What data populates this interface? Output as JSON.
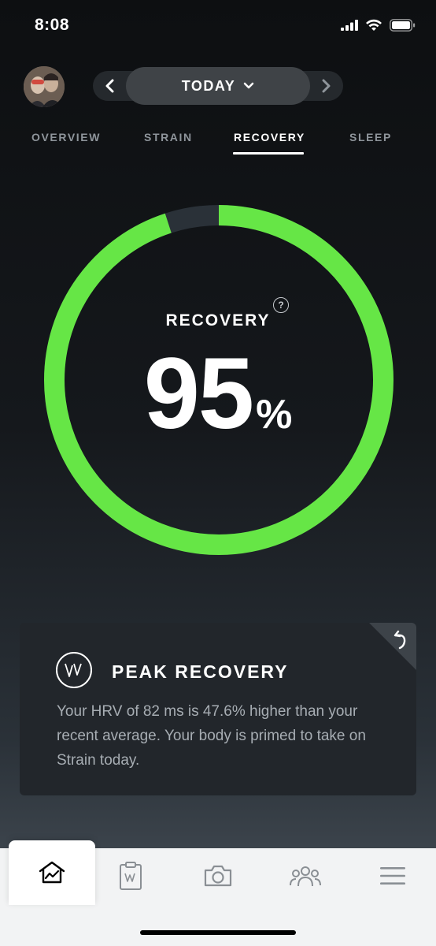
{
  "status_bar": {
    "time": "8:08",
    "signal_icon": "signal-bars-icon",
    "wifi_icon": "wifi-icon",
    "battery_icon": "battery-icon"
  },
  "header": {
    "date_label": "TODAY",
    "prev_icon": "chevron-left-icon",
    "next_icon": "chevron-right-icon",
    "dropdown_icon": "chevron-down-icon"
  },
  "tabs": [
    {
      "label": "OVERVIEW",
      "active": false
    },
    {
      "label": "STRAIN",
      "active": false
    },
    {
      "label": "RECOVERY",
      "active": true
    },
    {
      "label": "SLEEP",
      "active": false
    }
  ],
  "recovery": {
    "title": "RECOVERY",
    "help_label": "?",
    "value": "95",
    "unit": "%",
    "fraction": 0.95,
    "ring_color": "#66e646",
    "track_color": "#2a3138"
  },
  "card": {
    "title": "PEAK RECOVERY",
    "body": "Your HRV of 82 ms is 47.6% higher than your recent average. Your body is primed to take on Strain today.",
    "logo_icon": "whoop-logo-icon",
    "corner_icon": "flip-arrow-icon"
  },
  "tabbar": [
    {
      "name": "home",
      "icon": "home-chart-icon",
      "active": true
    },
    {
      "name": "journal",
      "icon": "clipboard-icon",
      "active": false
    },
    {
      "name": "camera",
      "icon": "camera-icon",
      "active": false
    },
    {
      "name": "community",
      "icon": "people-icon",
      "active": false
    },
    {
      "name": "menu",
      "icon": "hamburger-menu-icon",
      "active": false
    }
  ]
}
